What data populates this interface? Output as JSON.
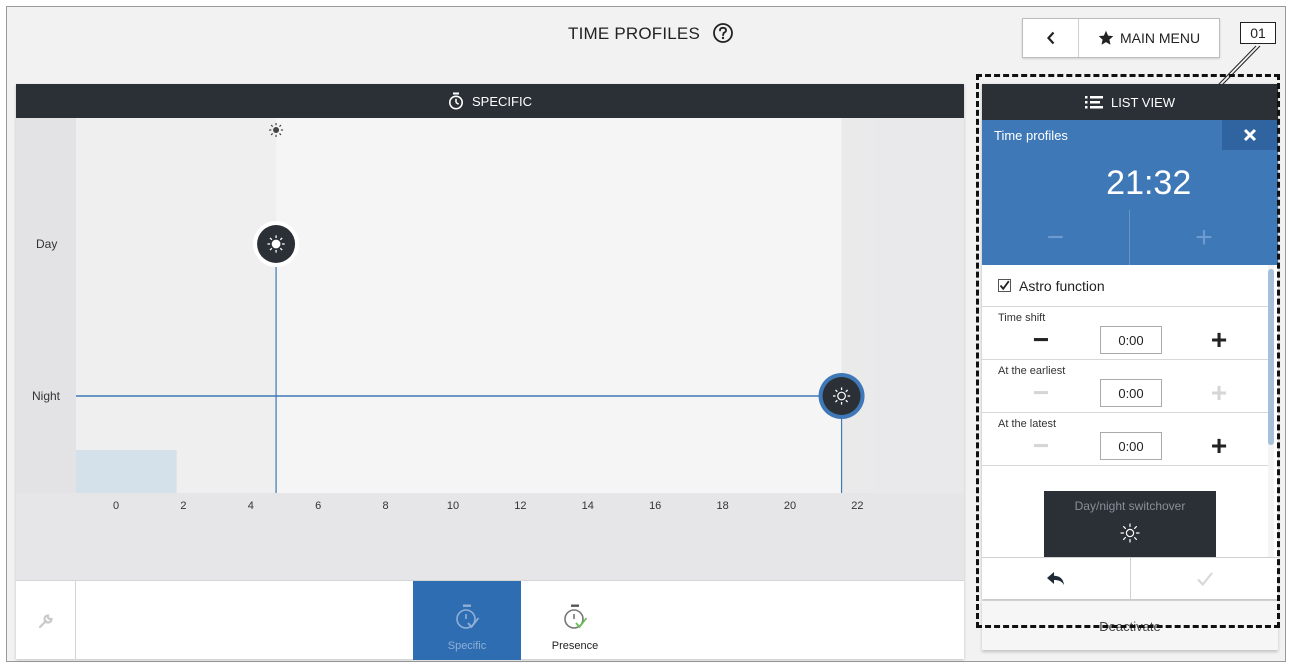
{
  "header": {
    "title": "TIME PROFILES",
    "help_icon": "question-circle-icon",
    "back_icon": "chevron-left-icon",
    "main_menu_label": "MAIN MENU",
    "main_menu_icon": "star-icon"
  },
  "callout": {
    "label": "01"
  },
  "chart_panel": {
    "header_label": "SPECIFIC",
    "header_icon": "stopwatch-icon",
    "top_markers": {
      "sun": "sun-icon",
      "moon": "moon-icon"
    },
    "y_labels": {
      "day": "Day",
      "night": "Night"
    },
    "accent_color": "#3e78b7"
  },
  "chart_data": {
    "type": "line",
    "x_ticks": [
      "0",
      "2",
      "4",
      "6",
      "8",
      "10",
      "12",
      "14",
      "16",
      "18",
      "20",
      "22"
    ],
    "xlim": [
      -1.2,
      24
    ],
    "y_categories": [
      "Night",
      "Day"
    ],
    "switch_points": [
      {
        "time_h": 4.75,
        "state": "Day",
        "icon": "sun-icon"
      },
      {
        "time_h": 21.53,
        "state": "Night",
        "icon": "sun-outline-icon"
      }
    ],
    "night_line_from_h": -1.2,
    "night_line_to_h": 21.53,
    "highlight_band_h": [
      -1.2,
      1.8
    ]
  },
  "bottom_tabs": {
    "wrench_icon": "wrench-icon",
    "items": [
      {
        "label": "Specific",
        "icon": "stopwatch-check-icon",
        "active": true
      },
      {
        "label": "Presence",
        "icon": "stopwatch-check-icon",
        "active": false
      }
    ]
  },
  "right_panel": {
    "list_view_label": "LIST VIEW",
    "list_view_icon": "list-icon",
    "profiles_title": "Time profiles",
    "close_icon": "close-icon",
    "time": "21:32",
    "time_icon": "moon-icon",
    "minus_symbol": "−",
    "plus_symbol": "+",
    "astro_label": "Astro function",
    "astro_checked": true,
    "settings": [
      {
        "label": "Time shift",
        "value": "0:00",
        "minus_enabled": true,
        "plus_enabled": true
      },
      {
        "label": "At the earliest",
        "value": "0:00",
        "minus_enabled": false,
        "plus_enabled": false
      },
      {
        "label": "At the latest",
        "value": "0:00",
        "minus_enabled": false,
        "plus_enabled": true
      }
    ],
    "switchover_label": "Day/night switchover",
    "switchover_icon": "sun-outline-icon",
    "footer_back_icon": "reply-arrow-icon",
    "footer_confirm_icon": "checkmark-icon"
  },
  "deactivate_label": "Deactivate"
}
